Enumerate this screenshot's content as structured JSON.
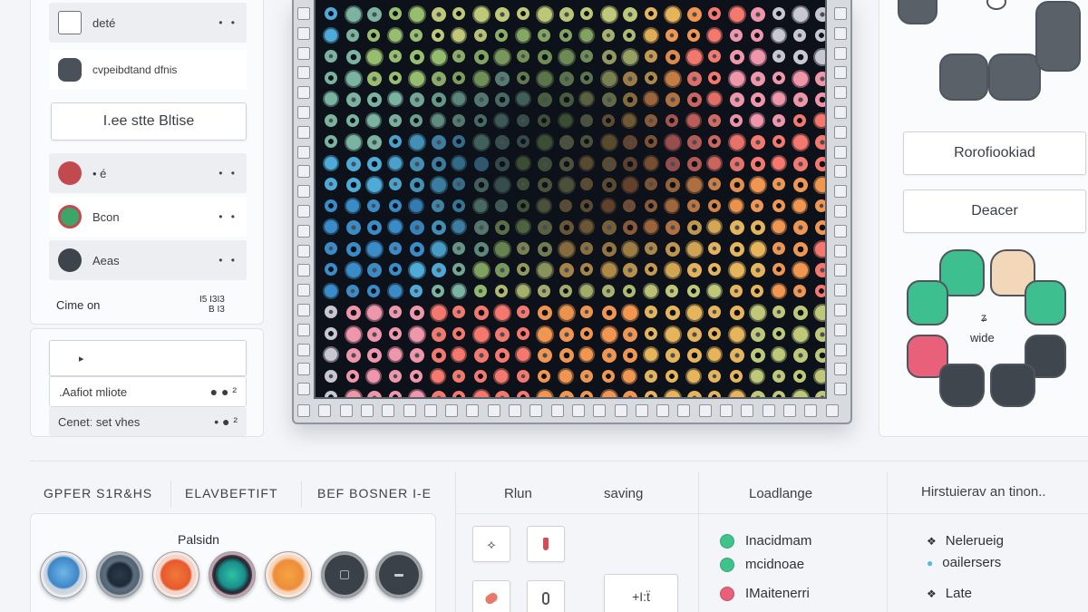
{
  "left_panel": {
    "rows": [
      {
        "label": "deté",
        "dots": "• •"
      },
      {
        "label": "cvpeibdtand dfnis",
        "dots": ""
      },
      {
        "label": "• é",
        "dots": "• •"
      },
      {
        "label": "Bcon",
        "dots": "• •"
      },
      {
        "label": "Aeas",
        "dots": "• •"
      }
    ],
    "button_label": "I.ee stte Bltise",
    "footer_label": "Cime on",
    "footer_value": "I5 I3I3\nB I3"
  },
  "left_lower_panel": {
    "input_value": "▸",
    "rows": [
      {
        "label": ".Aafiot mliote",
        "marks": "● ● ²"
      },
      {
        "label": "Cenetː set vhes",
        "marks": "• ● ²"
      }
    ]
  },
  "right_panel": {
    "button1_label": "Rorofiookiad",
    "button2_label": "Deacer",
    "wheel_label": "wide",
    "wheel_mark": "ʑ"
  },
  "bottom": {
    "tabs": [
      "GPFER S1R&HS",
      "ELAVBEFTIFT",
      "BEF BOSNER I-E"
    ],
    "palette_title": "Palsidn",
    "mid_tabs": [
      "Rlun",
      "saving"
    ],
    "col3_title": "Loadlange",
    "col3_items": [
      {
        "label": "Inacidmam",
        "color": "#3fc38a"
      },
      {
        "label": "mcidnoae",
        "color": "#3fc38a"
      },
      {
        "label": "IMaitenerri",
        "color": "#e8607a"
      }
    ],
    "col4_title": "Hirstuierav an tinon..",
    "col4_items": [
      {
        "label": "Nelerueig",
        "icon": "❖"
      },
      {
        "label": "oailersers",
        "icon": "●"
      },
      {
        "label": "Late",
        "icon": "❖"
      }
    ],
    "stepper_label": "+I:ẗ"
  },
  "colors": {
    "accent_green": "#3fc38a",
    "accent_red": "#e8607a",
    "grid_bg": "#0d1119"
  }
}
